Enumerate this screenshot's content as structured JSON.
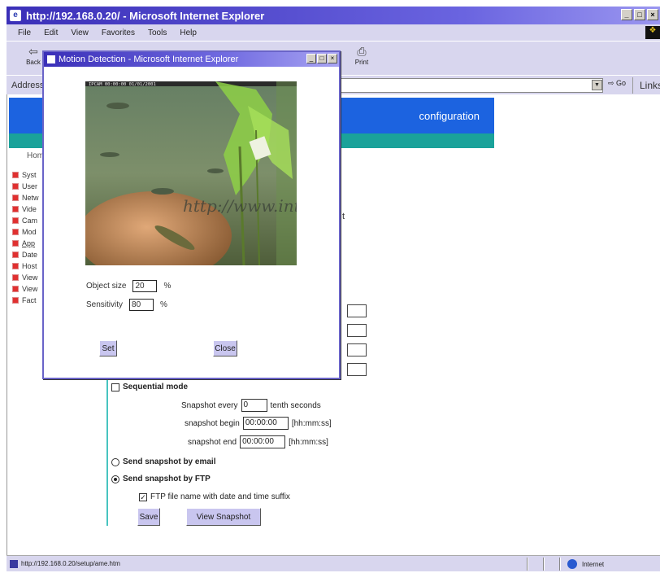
{
  "window": {
    "title": "http://192.168.0.20/ - Microsoft Internet Explorer",
    "menus": [
      "File",
      "Edit",
      "View",
      "Favorites",
      "Tools",
      "Help"
    ],
    "toolbar": {
      "back": "Back",
      "print": "Print"
    },
    "address_label": "Address",
    "go_label": "Go",
    "links_label": "Links"
  },
  "page": {
    "banner": "configuration",
    "sidebar": {
      "home": "Home",
      "items": [
        "Syst",
        "User",
        "Netw",
        "Vide",
        "Cam",
        "Mod",
        "App",
        "Date",
        "Host",
        "View",
        "View",
        "Fact"
      ]
    },
    "char_t": "t",
    "sequential": {
      "label": "Sequential mode",
      "checked": false
    },
    "snapshot_every": {
      "label": "Snapshot every",
      "value": "0",
      "suffix": "tenth seconds"
    },
    "snapshot_begin": {
      "label": "snapshot begin",
      "value": "00:00:00",
      "suffix": "[hh:mm:ss]"
    },
    "snapshot_end": {
      "label": "snapshot end",
      "value": "00:00:00",
      "suffix": "[hh:mm:ss]"
    },
    "send_email": {
      "label": "Send snapshot by email",
      "selected": false
    },
    "send_ftp": {
      "label": "Send snapshot by FTP",
      "selected": true
    },
    "ftp_suffix": {
      "label": "FTP file name with date and time suffix",
      "checked": true
    },
    "save_label": "Save",
    "view_snapshot_label": "View Snapshot"
  },
  "status": {
    "url": "http://192.168.0.20/setup/ame.htm",
    "zone": "Internet"
  },
  "popup": {
    "title": "Motion Detection - Microsoft Internet Explorer",
    "overlay": "IPCAM 00:00:00 01/01/2001",
    "watermark": "http://www.inter",
    "object_size": {
      "label": "Object size",
      "value": "20",
      "unit": "%"
    },
    "sensitivity": {
      "label": "Sensitivity",
      "value": "80",
      "unit": "%"
    },
    "set_label": "Set",
    "close_label": "Close"
  }
}
